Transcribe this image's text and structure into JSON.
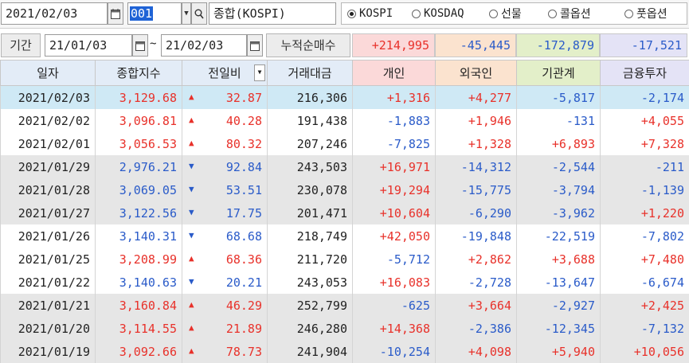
{
  "topbar": {
    "date_value": "2021/02/03",
    "code_value": "001",
    "index_name": "종합(KOSPI)",
    "markets": [
      {
        "label": "KOSPI",
        "selected": true
      },
      {
        "label": "KOSDAQ",
        "selected": false
      },
      {
        "label": "선물",
        "selected": false
      },
      {
        "label": "콜옵션",
        "selected": false
      },
      {
        "label": "풋옵션",
        "selected": false
      }
    ]
  },
  "period": {
    "label": "기간",
    "from": "21/01/03",
    "separator": "~",
    "to": "21/02/03",
    "sum_label": "누적순매수",
    "sums": [
      "+214,995",
      "-45,445",
      "-172,879",
      "-17,521"
    ]
  },
  "colors": {
    "up": "#e8312a",
    "down": "#2a5bc9",
    "selected_row": "#cfe9f5",
    "alt_row": "#e6e6e6"
  },
  "headers": [
    "일자",
    "종합지수",
    "전일비",
    "거래대금",
    "개인",
    "외국인",
    "기관계",
    "금융투자"
  ],
  "rows": [
    {
      "date": "2021/02/03",
      "index": "3,129.68",
      "dir": "up",
      "diff": "32.87",
      "amount": "216,306",
      "ind": "+1,316",
      "frg": "+4,277",
      "inst": "-5,817",
      "fin": "-2,174"
    },
    {
      "date": "2021/02/02",
      "index": "3,096.81",
      "dir": "up",
      "diff": "40.28",
      "amount": "191,438",
      "ind": "-1,883",
      "frg": "+1,946",
      "inst": "-131",
      "fin": "+4,055"
    },
    {
      "date": "2021/02/01",
      "index": "3,056.53",
      "dir": "up",
      "diff": "80.32",
      "amount": "207,246",
      "ind": "-7,825",
      "frg": "+1,328",
      "inst": "+6,893",
      "fin": "+7,328"
    },
    {
      "date": "2021/01/29",
      "index": "2,976.21",
      "dir": "down",
      "diff": "92.84",
      "amount": "243,503",
      "ind": "+16,971",
      "frg": "-14,312",
      "inst": "-2,544",
      "fin": "-211"
    },
    {
      "date": "2021/01/28",
      "index": "3,069.05",
      "dir": "down",
      "diff": "53.51",
      "amount": "230,078",
      "ind": "+19,294",
      "frg": "-15,775",
      "inst": "-3,794",
      "fin": "-1,139"
    },
    {
      "date": "2021/01/27",
      "index": "3,122.56",
      "dir": "down",
      "diff": "17.75",
      "amount": "201,471",
      "ind": "+10,604",
      "frg": "-6,290",
      "inst": "-3,962",
      "fin": "+1,220"
    },
    {
      "date": "2021/01/26",
      "index": "3,140.31",
      "dir": "down",
      "diff": "68.68",
      "amount": "218,749",
      "ind": "+42,050",
      "frg": "-19,848",
      "inst": "-22,519",
      "fin": "-7,802"
    },
    {
      "date": "2021/01/25",
      "index": "3,208.99",
      "dir": "up",
      "diff": "68.36",
      "amount": "211,720",
      "ind": "-5,712",
      "frg": "+2,862",
      "inst": "+3,688",
      "fin": "+7,480"
    },
    {
      "date": "2021/01/22",
      "index": "3,140.63",
      "dir": "down",
      "diff": "20.21",
      "amount": "243,053",
      "ind": "+16,083",
      "frg": "-2,728",
      "inst": "-13,647",
      "fin": "-6,674"
    },
    {
      "date": "2021/01/21",
      "index": "3,160.84",
      "dir": "up",
      "diff": "46.29",
      "amount": "252,799",
      "ind": "-625",
      "frg": "+3,664",
      "inst": "-2,927",
      "fin": "+2,425"
    },
    {
      "date": "2021/01/20",
      "index": "3,114.55",
      "dir": "up",
      "diff": "21.89",
      "amount": "246,280",
      "ind": "+14,368",
      "frg": "-2,386",
      "inst": "-12,345",
      "fin": "-7,132"
    },
    {
      "date": "2021/01/19",
      "index": "3,092.66",
      "dir": "up",
      "diff": "78.73",
      "amount": "241,904",
      "ind": "-10,254",
      "frg": "+4,098",
      "inst": "+5,940",
      "fin": "+10,056"
    }
  ]
}
